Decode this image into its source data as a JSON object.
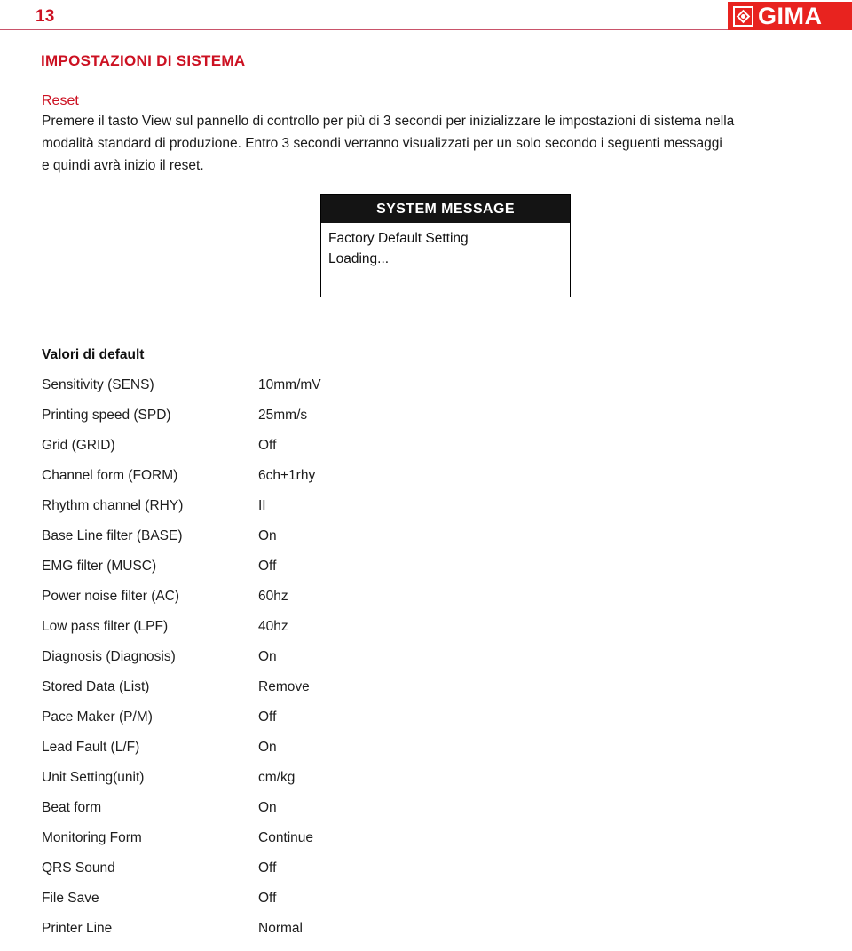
{
  "header": {
    "page_number": "13",
    "logo_text": "GIMA",
    "logo_mark_icon": "gima-diamond-icon"
  },
  "section": {
    "title": "IMPOSTAZIONI DI SISTEMA",
    "subsection": "Reset",
    "paragraph_lines": [
      "Premere il tasto View sul pannello di controllo per più di 3 secondi per inizializzare le impostazioni di sistema nella",
      "modalità standard di produzione. Entro 3 secondi verranno visualizzati per un solo secondo i seguenti messaggi",
      "e quindi avrà inizio il reset."
    ]
  },
  "system_message": {
    "header": "SYSTEM MESSAGE",
    "lines": [
      "Factory Default Setting",
      "Loading..."
    ]
  },
  "defaults": {
    "title": "Valori di default",
    "rows": [
      {
        "label": "Sensitivity (SENS)",
        "value": "10mm/mV"
      },
      {
        "label": "Printing speed (SPD)",
        "value": "25mm/s"
      },
      {
        "label": "Grid (GRID)",
        "value": "Off"
      },
      {
        "label": "Channel form (FORM)",
        "value": "6ch+1rhy"
      },
      {
        "label": "Rhythm channel (RHY)",
        "value": "II"
      },
      {
        "label": "Base Line filter (BASE)",
        "value": "On"
      },
      {
        "label": "EMG filter (MUSC)",
        "value": "Off"
      },
      {
        "label": "Power noise filter (AC)",
        "value": "60hz"
      },
      {
        "label": "Low pass filter (LPF)",
        "value": "40hz"
      },
      {
        "label": "Diagnosis (Diagnosis)",
        "value": "On"
      },
      {
        "label": "Stored Data (List)",
        "value": "Remove"
      },
      {
        "label": "Pace Maker (P/M)",
        "value": "Off"
      },
      {
        "label": "Lead Fault (L/F)",
        "value": "On"
      },
      {
        "label": "Unit Setting(unit)",
        "value": "cm/kg"
      },
      {
        "label": "Beat form",
        "value": "On"
      },
      {
        "label": "Monitoring Form",
        "value": "Continue"
      },
      {
        "label": "QRS Sound",
        "value": "Off"
      },
      {
        "label": "File Save",
        "value": "Off"
      },
      {
        "label": "Printer Line",
        "value": "Normal"
      }
    ]
  },
  "colors": {
    "brand_red": "#cc1122",
    "logo_red": "#e8231f",
    "rule_red": "#c9546a",
    "message_header_bg": "#141414"
  }
}
